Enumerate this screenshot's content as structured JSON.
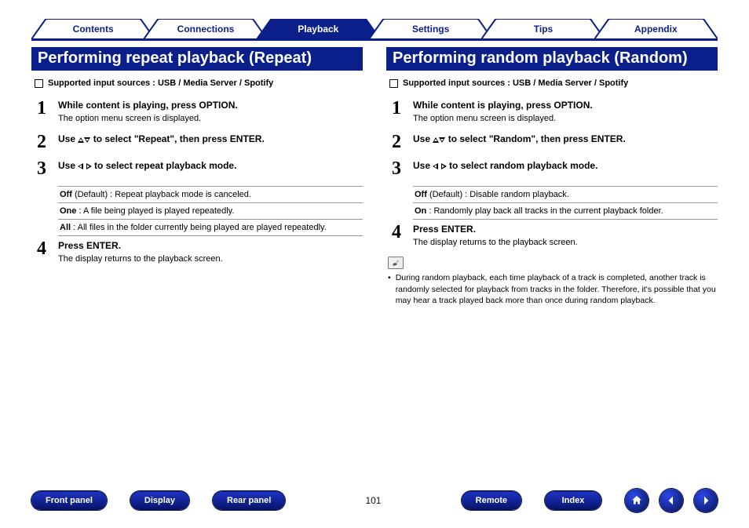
{
  "tabs": [
    {
      "label": "Contents",
      "active": false
    },
    {
      "label": "Connections",
      "active": false
    },
    {
      "label": "Playback",
      "active": true
    },
    {
      "label": "Settings",
      "active": false
    },
    {
      "label": "Tips",
      "active": false
    },
    {
      "label": "Appendix",
      "active": false
    }
  ],
  "left": {
    "heading": "Performing repeat playback (Repeat)",
    "supported": "Supported input sources : USB / Media Server / Spotify",
    "steps": [
      {
        "num": "1",
        "title": "While content is playing, press OPTION.",
        "sub": "The option menu screen is displayed."
      },
      {
        "num": "2",
        "title_pre": "Use ",
        "title_post": " to select \"Repeat\", then press ENTER.",
        "arrows": "ud"
      },
      {
        "num": "3",
        "title_pre": "Use ",
        "title_post": " to select repeat playback mode.",
        "arrows": "lr",
        "options": [
          {
            "k": "Off",
            "d": " (Default) : Repeat playback mode is canceled."
          },
          {
            "k": "One",
            "d": " : A file being played is played repeatedly."
          },
          {
            "k": "All",
            "d": " : All files in the folder currently being played are played repeatedly.",
            "just": true
          }
        ]
      },
      {
        "num": "4",
        "title": "Press ENTER.",
        "sub": "The display returns to the playback screen."
      }
    ]
  },
  "right": {
    "heading": "Performing random playback (Random)",
    "supported": "Supported input sources : USB / Media Server / Spotify",
    "steps": [
      {
        "num": "1",
        "title": "While content is playing, press OPTION.",
        "sub": "The option menu screen is displayed."
      },
      {
        "num": "2",
        "title_pre": "Use ",
        "title_post": " to select \"Random\", then press ENTER.",
        "arrows": "ud"
      },
      {
        "num": "3",
        "title_pre": "Use ",
        "title_post": " to select random playback mode.",
        "arrows": "lr",
        "options": [
          {
            "k": "Off",
            "d": " (Default) : Disable random playback."
          },
          {
            "k": "On",
            "d": " : Randomly play back all tracks in the current playback folder."
          }
        ]
      },
      {
        "num": "4",
        "title": "Press ENTER.",
        "sub": "The display returns to the playback screen."
      }
    ],
    "note": "During random playback, each time playback of a track is completed, another track is randomly selected for playback from tracks in the folder. Therefore, it's possible that you may hear a track played back more than once during random playback."
  },
  "footer": {
    "buttons_left": [
      "Front panel",
      "Display",
      "Rear panel"
    ],
    "page": "101",
    "buttons_right": [
      "Remote",
      "Index"
    ]
  }
}
